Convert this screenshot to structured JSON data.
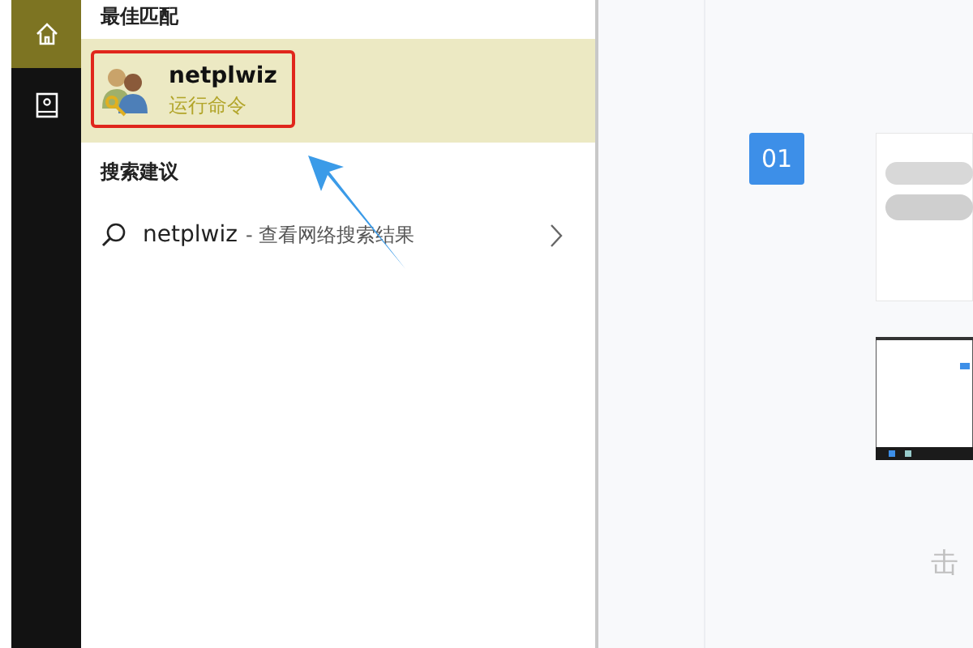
{
  "rail": {
    "items": [
      {
        "kind": "home",
        "selected": true
      },
      {
        "kind": "book",
        "selected": false
      }
    ]
  },
  "best_match": {
    "heading": "最佳匹配",
    "item": {
      "title": "netplwiz",
      "subtitle": "运行命令",
      "selected": true
    }
  },
  "suggestions": {
    "heading": "搜索建议",
    "items": [
      {
        "query": "netplwiz",
        "detail": "- 查看网络搜索结果"
      }
    ]
  },
  "background_page": {
    "step_badge": "01",
    "text_fragment": "击"
  },
  "annotations": {
    "highlight_box": true,
    "pointer_arrow": true
  }
}
